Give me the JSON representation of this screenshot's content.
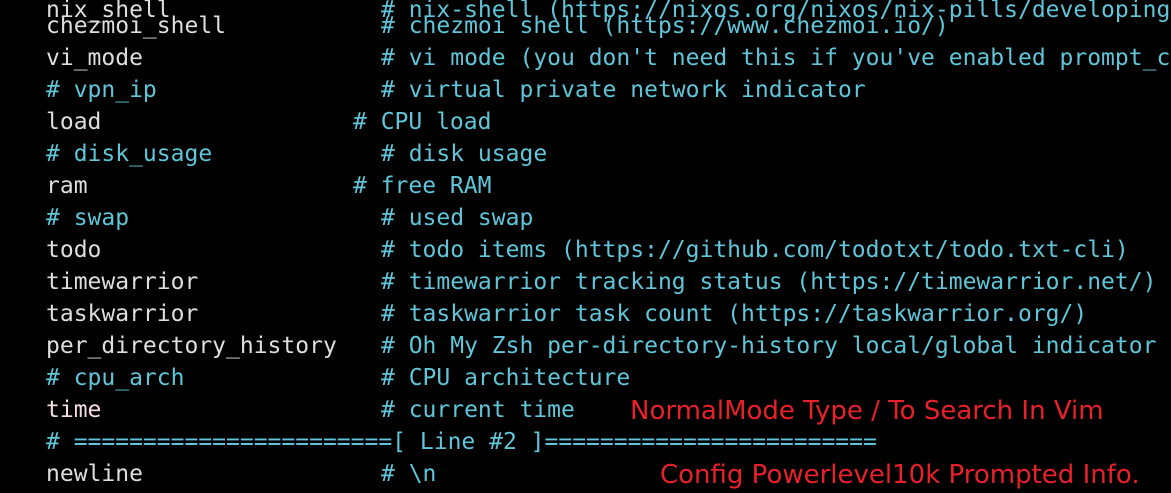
{
  "colors": {
    "background": "#000000",
    "segment_text": "#dedede",
    "commented_segment": "#5fc6d9",
    "comment_text": "#5fc6d9",
    "highlight_segment": "#f5dde0",
    "annotation": "#e8202a"
  },
  "terminal": {
    "lines": [
      {
        "segment": "nix_shell",
        "comment": "# nix-shell (https://nixos.org/nixos/nix-pills/developing-with-nix-shell.html)",
        "commented": false
      },
      {
        "segment": "chezmoi_shell",
        "comment": "# chezmoi shell (https://www.chezmoi.io/)",
        "commented": false
      },
      {
        "segment": "vi_mode",
        "comment": "# vi mode (you don't need this if you've enabled prompt_char)",
        "commented": false
      },
      {
        "segment": "# vpn_ip",
        "comment": "# virtual private network indicator",
        "commented": true
      },
      {
        "segment": "load",
        "comment": "# CPU load",
        "commented": false
      },
      {
        "segment": "# disk_usage",
        "comment": "# disk usage",
        "commented": true
      },
      {
        "segment": "ram",
        "comment": "# free RAM",
        "commented": false
      },
      {
        "segment": "# swap",
        "comment": "# used swap",
        "commented": true
      },
      {
        "segment": "todo",
        "comment": "# todo items (https://github.com/todotxt/todo.txt-cli)",
        "commented": false
      },
      {
        "segment": "timewarrior",
        "comment": "# timewarrior tracking status (https://timewarrior.net/)",
        "commented": false
      },
      {
        "segment": "taskwarrior",
        "comment": "# taskwarrior task count (https://taskwarrior.org/)",
        "commented": false
      },
      {
        "segment": "per_directory_history",
        "comment": "# Oh My Zsh per-directory-history local/global indicator",
        "commented": false
      },
      {
        "segment": "# cpu_arch",
        "comment": "# CPU architecture",
        "commented": true
      },
      {
        "segment": "time",
        "comment": "# current time",
        "commented": false,
        "highlight": true
      },
      {
        "segment": "# =======================[ Line #2 ]========================",
        "comment": "",
        "commented": true
      },
      {
        "segment": "newline",
        "comment": "# \\n",
        "commented": false
      }
    ]
  },
  "annotations": {
    "normal_mode_hint": "NormalMode Type / To Search In Vim",
    "config_caption": "Config Powerlevel10k Prompted Info."
  }
}
